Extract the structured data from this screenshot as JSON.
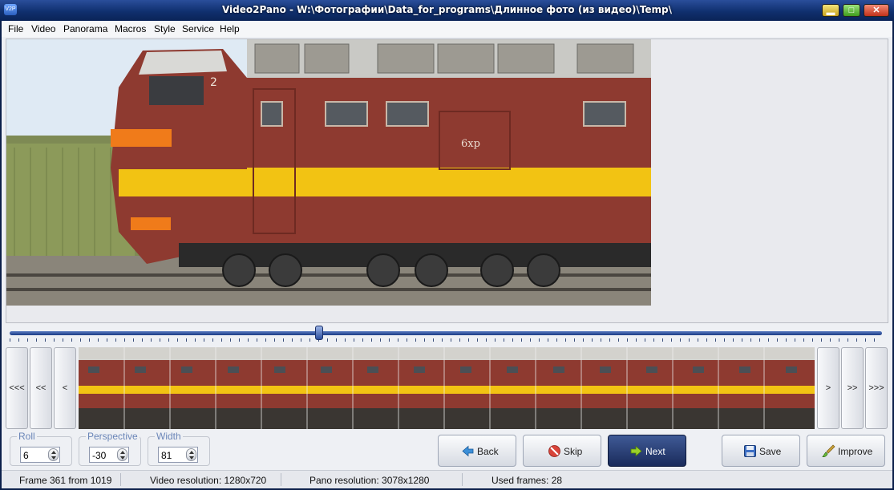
{
  "window": {
    "title": "Video2Pano - W:\\Фотографии\\Data_for_programs\\Длинное фото (из видео)\\Temp\\",
    "app_icon_text": "V2P"
  },
  "menu": [
    "File",
    "Video",
    "Panorama",
    "Macros",
    "Style",
    "Service",
    "Help"
  ],
  "photo": {
    "cab_number": "2",
    "side_text": "6хр"
  },
  "filmstrip": {
    "nav": [
      "<<<",
      "<<",
      "<",
      ">",
      ">>",
      ">>>"
    ]
  },
  "controls": {
    "roll": {
      "label": "Roll",
      "value": "6"
    },
    "perspective": {
      "label": "Perspective",
      "value": "-30"
    },
    "width": {
      "label": "Width",
      "value": "81"
    }
  },
  "buttons": {
    "back": "Back",
    "skip": "Skip",
    "next": "Next",
    "save": "Save",
    "improve": "Improve"
  },
  "status": {
    "frame": "Frame 361 from 1019",
    "video_resolution": "Video resolution: 1280x720",
    "pano_resolution": "Pano resolution: 3078x1280",
    "used_frames": "Used frames:  28"
  },
  "colors": {
    "locomotive_red": "#8e3a30",
    "stripe_yellow": "#f2c313",
    "stripe_orange": "#f07b1a",
    "next_button": "#22356a"
  }
}
